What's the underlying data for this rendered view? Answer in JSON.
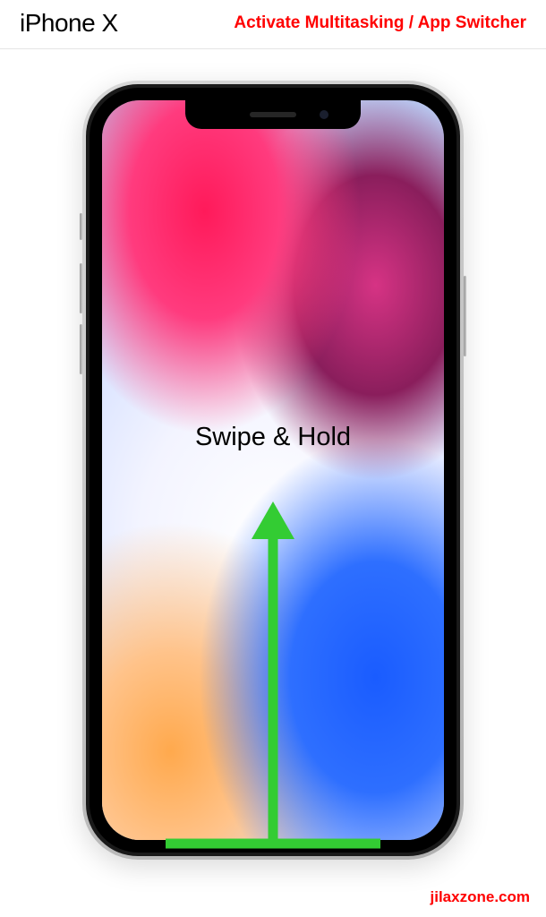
{
  "header": {
    "device_name": "iPhone X",
    "instruction_title": "Activate Multitasking / App Switcher"
  },
  "gesture": {
    "label": "Swipe & Hold",
    "arrow_color": "#33cc33"
  },
  "footer": {
    "site": "jilaxzone.com"
  }
}
